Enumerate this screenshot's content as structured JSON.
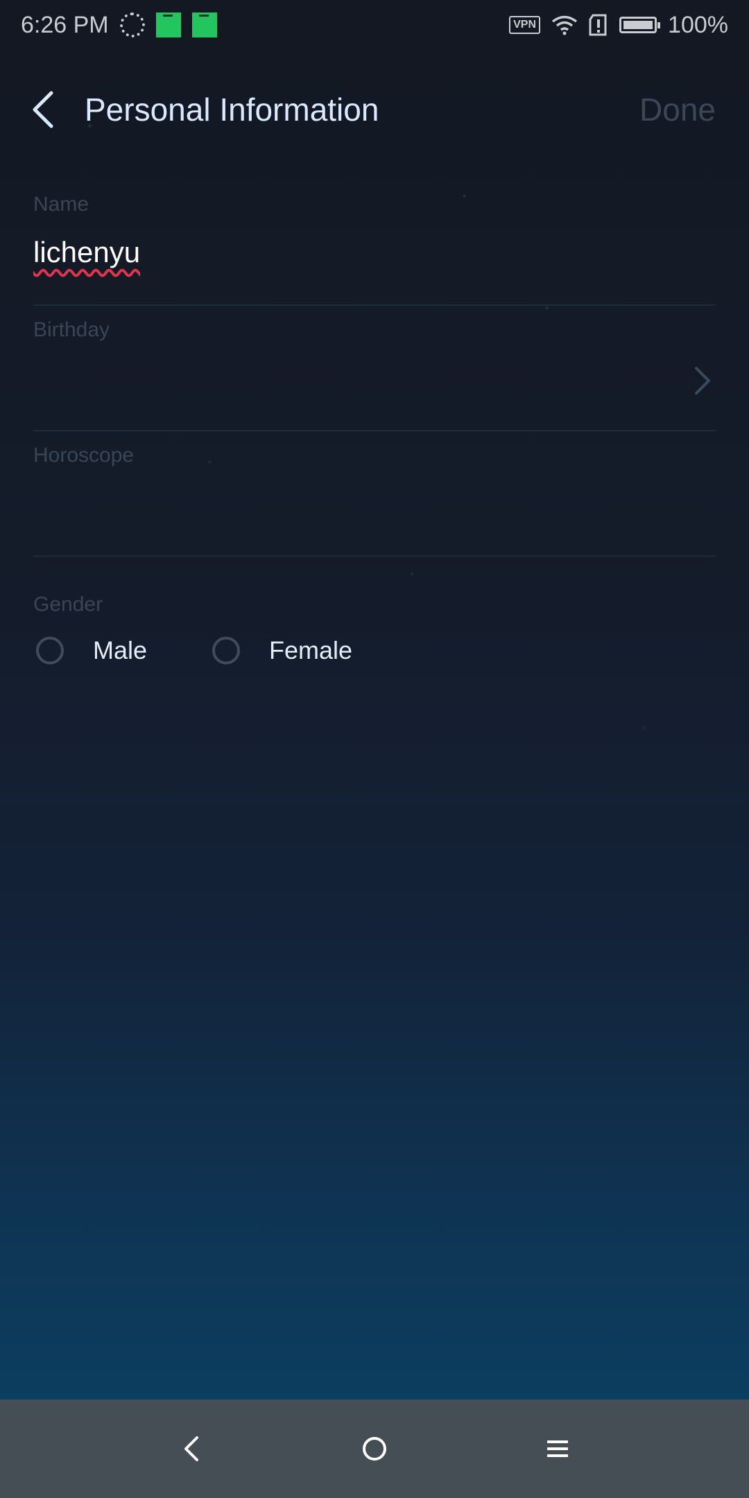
{
  "status_bar": {
    "time": "6:26 PM",
    "vpn": "VPN",
    "battery": "100%"
  },
  "header": {
    "title": "Personal Information",
    "done_label": "Done"
  },
  "form": {
    "name": {
      "label": "Name",
      "value": "lichenyu"
    },
    "birthday": {
      "label": "Birthday",
      "value": ""
    },
    "horoscope": {
      "label": "Horoscope",
      "value": ""
    },
    "gender": {
      "label": "Gender",
      "options": [
        "Male",
        "Female"
      ],
      "selected": null
    }
  },
  "colors": {
    "title": "#dbe9ff",
    "done_disabled": "#3c4656",
    "label": "#3a4556",
    "nav_bar": "#454d55",
    "spellcheck_underline": "#e5334a"
  },
  "icons": {
    "status": [
      "sync-icon",
      "app-icon",
      "app-icon",
      "vpn-icon",
      "wifi-icon",
      "alert-icon",
      "battery-icon"
    ],
    "nav": [
      "back-icon",
      "home-icon",
      "menu-icon"
    ]
  }
}
